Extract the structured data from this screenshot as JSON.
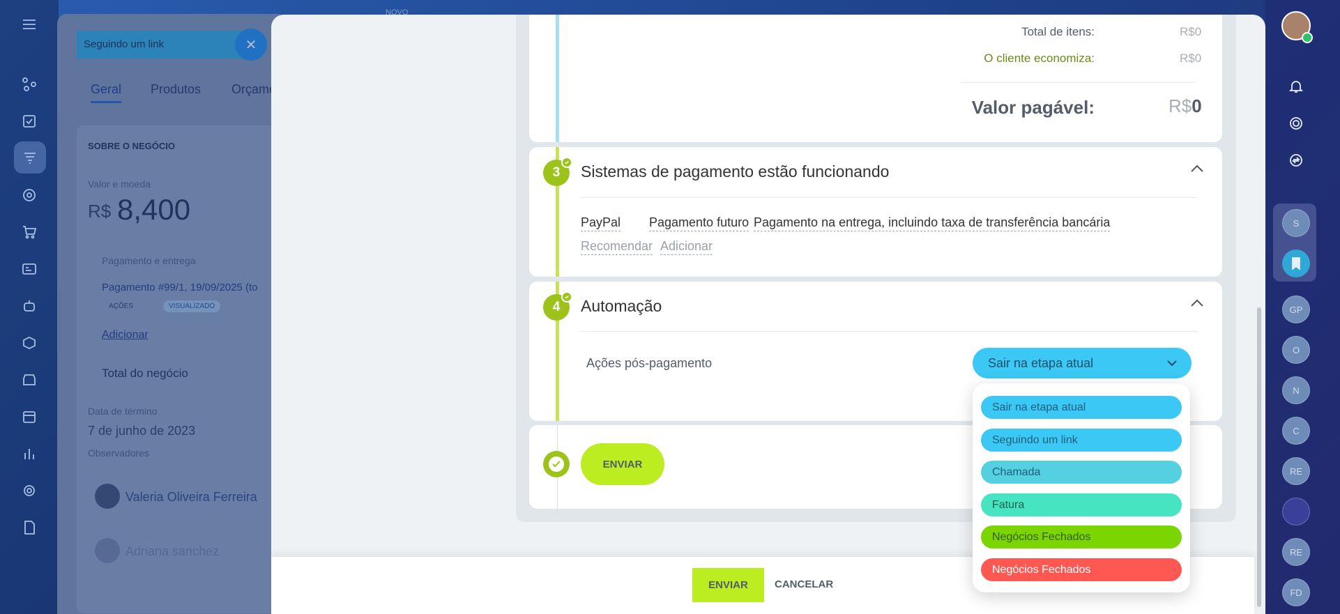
{
  "background": {
    "dimmed_label": "NOVO",
    "deal": {
      "header_input": "Seguindo um link",
      "tabs": [
        "Geral",
        "Produtos",
        "Orçame"
      ],
      "section_title": "SOBRE O NEGÓCIO",
      "amount_label": "Valor e moeda",
      "currency": "R$",
      "amount": "8,400",
      "payment_label": "Pagamento e entrega",
      "payment_item": "Pagamento #99/1, 19/09/2025 (to",
      "actions_label": "AÇÕES",
      "viewed_badge": "VISUALIZADO",
      "add_link": "Adicionar",
      "total_label": "Total do negócio",
      "end_date_label": "Data de término",
      "end_date": "7 de junho de 2023",
      "observers_label": "Observadores",
      "observers": [
        "Valeria Oliveira Ferreira",
        "Adriana sanchez"
      ]
    }
  },
  "summary": {
    "total_items_label": "Total de itens:",
    "total_items_value": "R$0",
    "saves_label": "O cliente economiza:",
    "saves_value": "R$0",
    "payable_label": "Valor pagável:",
    "payable_currency": "R$",
    "payable_value": "0"
  },
  "step3": {
    "number": "3",
    "title": "Sistemas de pagamento estão funcionando",
    "systems": [
      "PayPal",
      "Pagamento futuro",
      "Pagamento na entrega, incluindo taxa de transferência bancária"
    ],
    "recommend": "Recomendar",
    "add": "Adicionar"
  },
  "step4": {
    "number": "4",
    "title": "Automação",
    "label": "Ações pós-pagamento",
    "selected": "Sair na etapa atual"
  },
  "step5": {
    "button": "ENVIAR"
  },
  "dropdown_options": [
    {
      "label": "Sair na etapa atual",
      "color": "#3bc8f5",
      "text_color": "#1d5f7c"
    },
    {
      "label": "Seguindo um link",
      "color": "#3bc8f5",
      "text_color": "#1d5f7c"
    },
    {
      "label": "Chamada",
      "color": "#55d0e0",
      "text_color": "#1d5f7c"
    },
    {
      "label": "Fatura",
      "color": "#47e4c2",
      "text_color": "#1d6052"
    },
    {
      "label": "Negócios Fechados",
      "color": "#7bd500",
      "text_color": "#355e00"
    },
    {
      "label": "Negócios Fechados",
      "color": "#ff5752",
      "text_color": "#ffffff"
    }
  ],
  "footer": {
    "save": "ENVIAR",
    "cancel": "CANCELAR"
  },
  "right_rail": {
    "avatars": [
      "S",
      "GP",
      "O",
      "N",
      "C",
      "RE",
      "RE",
      "FD"
    ]
  },
  "colors": {
    "accent_green": "#bbed21",
    "step_green": "#9dc31a",
    "dropdown_blue": "#3bc8f5"
  }
}
